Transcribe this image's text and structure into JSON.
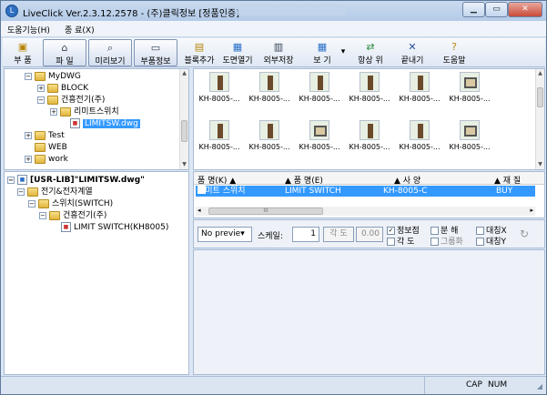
{
  "window": {
    "title": "LiveClick Ver.2.3.12.2578 - (주)클릭정보 [정품인증]",
    "min_label": "▁",
    "max_label": "▭",
    "close_label": "✕"
  },
  "menu": {
    "help": "도움기능(H)",
    "exit": "종 료(X)"
  },
  "toolbar": {
    "items": [
      {
        "label": "부 품",
        "icon": "parts-icon"
      },
      {
        "label": "파 일",
        "icon": "file-icon"
      },
      {
        "label": "미리보기",
        "icon": "preview-icon"
      },
      {
        "label": "부품정보",
        "icon": "part-info-icon"
      },
      {
        "label": "블록추가",
        "icon": "add-block-icon"
      },
      {
        "label": "도면열기",
        "icon": "open-drawing-icon"
      },
      {
        "label": "외부저장",
        "icon": "export-icon"
      },
      {
        "label": "보 기",
        "icon": "view-icon"
      },
      {
        "label": "항상 위",
        "icon": "always-on-top-icon"
      },
      {
        "label": "끝내기",
        "icon": "exit-icon"
      },
      {
        "label": "도움말",
        "icon": "help-icon"
      }
    ]
  },
  "folder_tree": {
    "items": [
      {
        "label": "MyDWG"
      },
      {
        "label": "BLOCK"
      },
      {
        "label": "건흥전기(주)"
      },
      {
        "label": "리미트스위치"
      },
      {
        "label": "LIMITSW.dwg"
      },
      {
        "label": "Test"
      },
      {
        "label": "WEB"
      },
      {
        "label": "work"
      }
    ]
  },
  "thumbnails": {
    "captions": [
      "KH-8005-...",
      "KH-8005-...",
      "KH-8005-...",
      "KH-8005-...",
      "KH-8005-...",
      "KH-8005-...",
      "KH-8005-...",
      "KH-8005-...",
      "KH-8005-...",
      "KH-8005-...",
      "KH-8005-...",
      "KH-8005-..."
    ]
  },
  "lib_tree": {
    "root": "[USR-LIB]\"LIMITSW.dwg\"",
    "level1": "전기&전자계열",
    "level2": "스위치(SWITCH)",
    "level3": "건흥전기(주)",
    "level4": "LIMIT SWITCH(KH8005)"
  },
  "grid": {
    "columns": [
      {
        "label": "품 명(K) ▲"
      },
      {
        "label": "▲ 품 명(E)"
      },
      {
        "label": "▲ 사 양"
      },
      {
        "label": "▲ 재 질"
      }
    ],
    "row": {
      "name_k": "리미트 스위치",
      "name_e": "LIMIT SWITCH",
      "spec": "KH-8005-C",
      "material": "BUY"
    },
    "scroll_left": "◂",
    "scroll_right": "▸",
    "scroll_grip": "III"
  },
  "preview_controls": {
    "mode": "No previe▾",
    "scale_label": "스케일:",
    "scale_value": "1",
    "angle_label": "각 도",
    "angle_value": "0.00",
    "info_point": "정보점",
    "angle2": "각 도",
    "split": "분 해",
    "group": "그룹화",
    "sym_x": "대칭X",
    "sym_y": "대칭Y"
  },
  "status": {
    "cap": "CAP",
    "num": "NUM"
  }
}
